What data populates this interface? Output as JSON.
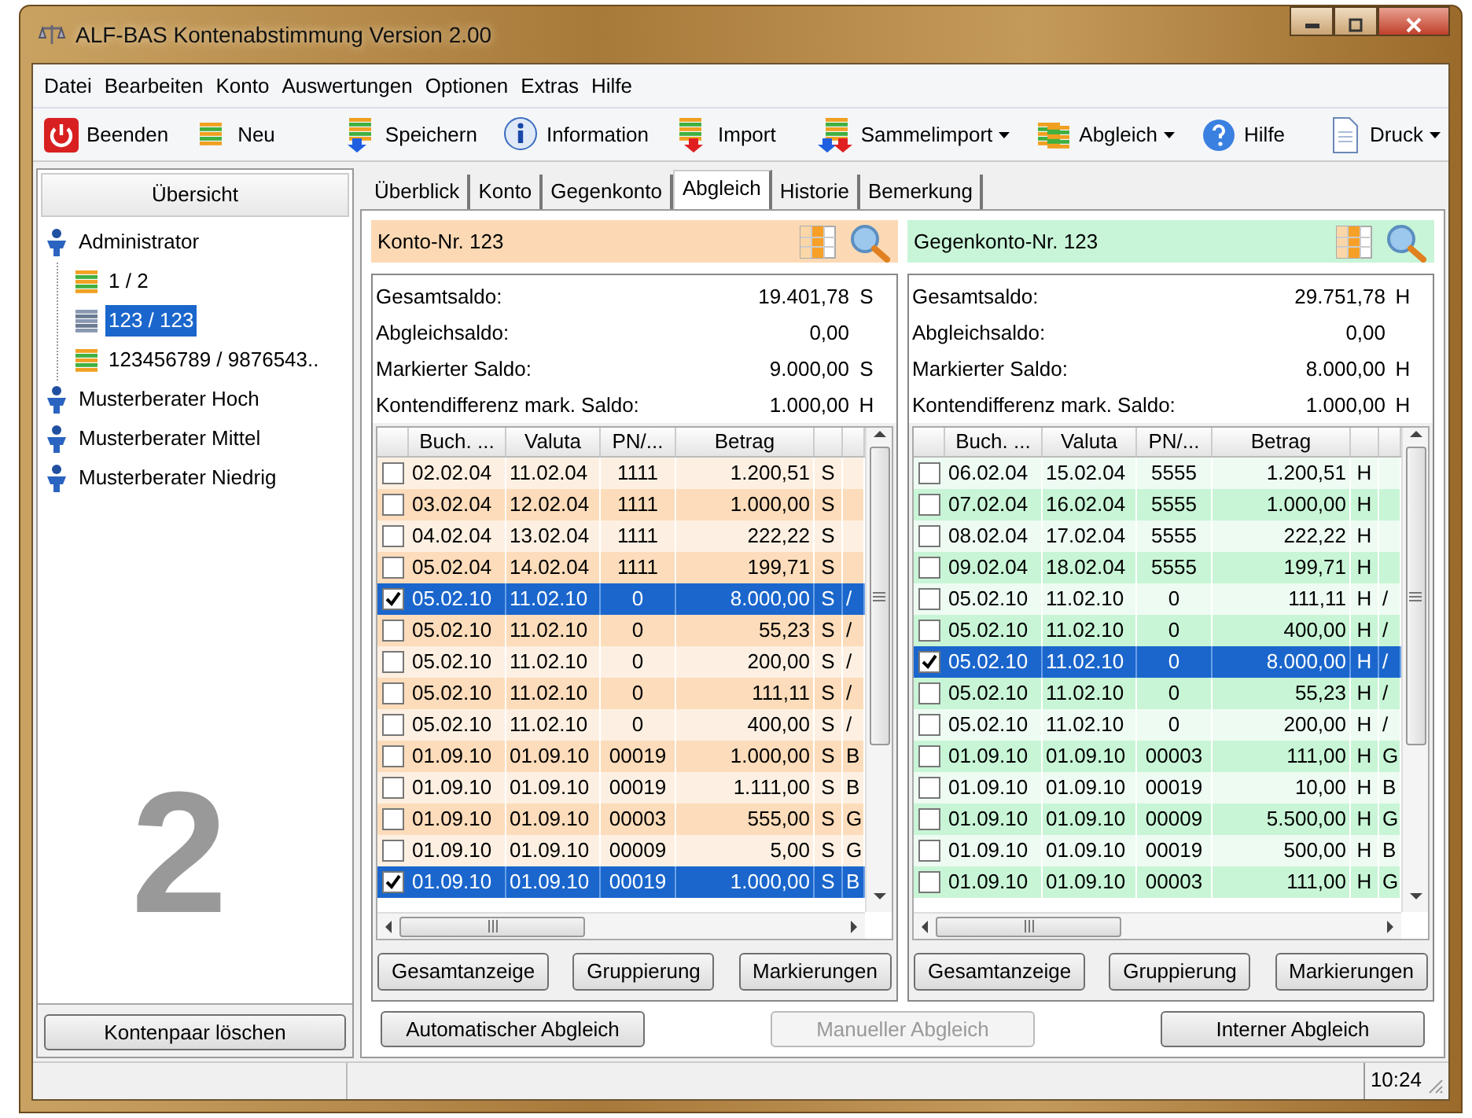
{
  "window": {
    "title": "ALF-BAS Kontenabstimmung Version 2.00"
  },
  "menu": [
    "Datei",
    "Bearbeiten",
    "Konto",
    "Auswertungen",
    "Optionen",
    "Extras",
    "Hilfe"
  ],
  "toolbar": [
    {
      "label": "Beenden",
      "kind": "exit",
      "dropdown": false
    },
    {
      "label": "Neu",
      "kind": "new",
      "dropdown": false
    },
    {
      "label": "Speichern",
      "kind": "save",
      "dropdown": false
    },
    {
      "label": "Information",
      "kind": "info",
      "dropdown": false
    },
    {
      "label": "Import",
      "kind": "import",
      "dropdown": false
    },
    {
      "label": "Sammelimport",
      "kind": "batch",
      "dropdown": true
    },
    {
      "label": "Abgleich",
      "kind": "reconcile",
      "dropdown": true
    },
    {
      "label": "Hilfe",
      "kind": "help",
      "dropdown": false
    },
    {
      "label": "Druck",
      "kind": "print",
      "dropdown": true
    }
  ],
  "sidebar": {
    "title": "Übersicht",
    "tree": [
      {
        "label": "Administrator",
        "kind": "user",
        "selected": false,
        "children": [
          {
            "label": "1 / 2",
            "kind": "account",
            "selected": false
          },
          {
            "label": "123 / 123",
            "kind": "account",
            "selected": true
          },
          {
            "label": "123456789 / 9876543..",
            "kind": "account",
            "selected": false
          }
        ]
      },
      {
        "label": "Musterberater Hoch",
        "kind": "user",
        "selected": false
      },
      {
        "label": "Musterberater Mittel",
        "kind": "user",
        "selected": false
      },
      {
        "label": "Musterberater Niedrig",
        "kind": "user",
        "selected": false
      }
    ],
    "big_number": "2",
    "button": "Kontenpaar löschen"
  },
  "tabs": [
    {
      "label": "Überblick",
      "selected": false
    },
    {
      "label": "Konto",
      "selected": false
    },
    {
      "label": "Gegenkonto",
      "selected": false
    },
    {
      "label": "Abgleich",
      "selected": true
    },
    {
      "label": "Historie",
      "selected": false
    },
    {
      "label": "Bemerkung",
      "selected": false
    }
  ],
  "panels": [
    {
      "kind": "konto",
      "title": "Konto-Nr. 123",
      "summary": [
        {
          "label": "Gesamtsaldo:",
          "value": "19.401,78",
          "side": "S"
        },
        {
          "label": "Abgleichsaldo:",
          "value": "0,00"
        },
        {
          "label": "Markierter Saldo:",
          "value": "9.000,00",
          "side": "S"
        },
        {
          "label": "Kontendifferenz mark. Saldo:",
          "value": "1.000,00",
          "side": "H"
        }
      ],
      "columns": [
        "Buch. ...",
        "Valuta",
        "PN/...",
        "Betrag"
      ],
      "rows": [
        {
          "checked": false,
          "selected": false,
          "cells": [
            "02.02.04",
            "11.02.04",
            "1111",
            "1.200,51",
            "S"
          ]
        },
        {
          "checked": false,
          "selected": false,
          "cells": [
            "03.02.04",
            "12.02.04",
            "1111",
            "1.000,00",
            "S"
          ]
        },
        {
          "checked": false,
          "selected": false,
          "cells": [
            "04.02.04",
            "13.02.04",
            "1111",
            "222,22",
            "S"
          ]
        },
        {
          "checked": false,
          "selected": false,
          "cells": [
            "05.02.04",
            "14.02.04",
            "1111",
            "199,71",
            "S"
          ]
        },
        {
          "checked": true,
          "selected": true,
          "cells": [
            "05.02.10",
            "11.02.10",
            "0",
            "8.000,00",
            "S",
            "/"
          ]
        },
        {
          "checked": false,
          "selected": false,
          "cells": [
            "05.02.10",
            "11.02.10",
            "0",
            "55,23",
            "S",
            "/"
          ]
        },
        {
          "checked": false,
          "selected": false,
          "cells": [
            "05.02.10",
            "11.02.10",
            "0",
            "200,00",
            "S",
            "/"
          ]
        },
        {
          "checked": false,
          "selected": false,
          "cells": [
            "05.02.10",
            "11.02.10",
            "0",
            "111,11",
            "S",
            "/"
          ]
        },
        {
          "checked": false,
          "selected": false,
          "cells": [
            "05.02.10",
            "11.02.10",
            "0",
            "400,00",
            "S",
            "/"
          ]
        },
        {
          "checked": false,
          "selected": false,
          "cells": [
            "01.09.10",
            "01.09.10",
            "00019",
            "1.000,00",
            "S",
            "B"
          ]
        },
        {
          "checked": false,
          "selected": false,
          "cells": [
            "01.09.10",
            "01.09.10",
            "00019",
            "1.111,00",
            "S",
            "B"
          ]
        },
        {
          "checked": false,
          "selected": false,
          "cells": [
            "01.09.10",
            "01.09.10",
            "00003",
            "555,00",
            "S",
            "G"
          ]
        },
        {
          "checked": false,
          "selected": false,
          "cells": [
            "01.09.10",
            "01.09.10",
            "00009",
            "5,00",
            "S",
            "G"
          ]
        },
        {
          "checked": true,
          "selected": true,
          "cells": [
            "01.09.10",
            "01.09.10",
            "00019",
            "1.000,00",
            "S",
            "B"
          ]
        }
      ],
      "buttons": [
        "Gesamtanzeige",
        "Gruppierung",
        "Markierungen"
      ]
    },
    {
      "kind": "gegenkonto",
      "title": "Gegenkonto-Nr. 123",
      "summary": [
        {
          "label": "Gesamtsaldo:",
          "value": "29.751,78",
          "side": "H"
        },
        {
          "label": "Abgleichsaldo:",
          "value": "0,00"
        },
        {
          "label": "Markierter Saldo:",
          "value": "8.000,00",
          "side": "H"
        },
        {
          "label": "Kontendifferenz mark. Saldo:",
          "value": "1.000,00",
          "side": "H"
        }
      ],
      "columns": [
        "Buch. ...",
        "Valuta",
        "PN/...",
        "Betrag"
      ],
      "rows": [
        {
          "checked": false,
          "selected": false,
          "cells": [
            "06.02.04",
            "15.02.04",
            "5555",
            "1.200,51",
            "H"
          ]
        },
        {
          "checked": false,
          "selected": false,
          "cells": [
            "07.02.04",
            "16.02.04",
            "5555",
            "1.000,00",
            "H"
          ]
        },
        {
          "checked": false,
          "selected": false,
          "cells": [
            "08.02.04",
            "17.02.04",
            "5555",
            "222,22",
            "H"
          ]
        },
        {
          "checked": false,
          "selected": false,
          "cells": [
            "09.02.04",
            "18.02.04",
            "5555",
            "199,71",
            "H"
          ]
        },
        {
          "checked": false,
          "selected": false,
          "cells": [
            "05.02.10",
            "11.02.10",
            "0",
            "111,11",
            "H",
            "/"
          ]
        },
        {
          "checked": false,
          "selected": false,
          "cells": [
            "05.02.10",
            "11.02.10",
            "0",
            "400,00",
            "H",
            "/"
          ]
        },
        {
          "checked": true,
          "selected": true,
          "cells": [
            "05.02.10",
            "11.02.10",
            "0",
            "8.000,00",
            "H",
            "/"
          ]
        },
        {
          "checked": false,
          "selected": false,
          "cells": [
            "05.02.10",
            "11.02.10",
            "0",
            "55,23",
            "H",
            "/"
          ]
        },
        {
          "checked": false,
          "selected": false,
          "cells": [
            "05.02.10",
            "11.02.10",
            "0",
            "200,00",
            "H",
            "/"
          ]
        },
        {
          "checked": false,
          "selected": false,
          "cells": [
            "01.09.10",
            "01.09.10",
            "00003",
            "111,00",
            "H",
            "G"
          ]
        },
        {
          "checked": false,
          "selected": false,
          "cells": [
            "01.09.10",
            "01.09.10",
            "00019",
            "10,00",
            "H",
            "B"
          ]
        },
        {
          "checked": false,
          "selected": false,
          "cells": [
            "01.09.10",
            "01.09.10",
            "00009",
            "5.500,00",
            "H",
            "G"
          ]
        },
        {
          "checked": false,
          "selected": false,
          "cells": [
            "01.09.10",
            "01.09.10",
            "00019",
            "500,00",
            "H",
            "B"
          ]
        },
        {
          "checked": false,
          "selected": false,
          "cells": [
            "01.09.10",
            "01.09.10",
            "00003",
            "111,00",
            "H",
            "G"
          ]
        }
      ],
      "buttons": [
        "Gesamtanzeige",
        "Gruppierung",
        "Markierungen"
      ]
    }
  ],
  "actions": [
    {
      "label": "Automatischer Abgleich",
      "disabled": false
    },
    {
      "label": "Manueller Abgleich",
      "disabled": true
    },
    {
      "label": "Interner Abgleich",
      "disabled": false
    }
  ],
  "status_bar": {
    "time": "10:24"
  }
}
